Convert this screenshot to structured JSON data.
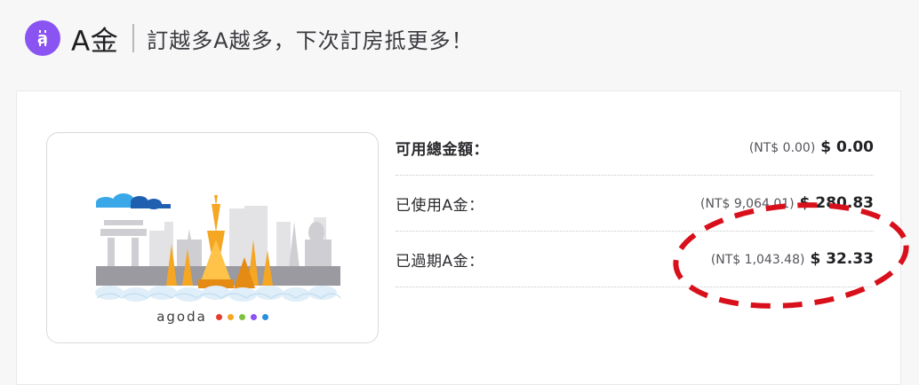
{
  "header": {
    "brand": "A金",
    "tagline": "訂越多A越多，下次訂房抵更多！",
    "coin_icon": "dollar-coin-icon",
    "accent": "#8a54f2"
  },
  "gift_card": {
    "logo_text": "agoda",
    "dot_colors": [
      "#e63b2e",
      "#f5a623",
      "#7fc242",
      "#8a54f2",
      "#2a8fe0"
    ]
  },
  "balances": [
    {
      "label": "可用總金額：",
      "ntd": "(NT$ 0.00)",
      "usd": "$ 0.00"
    },
    {
      "label": "已使用A金：",
      "ntd": "(NT$ 9,064.01)",
      "usd": "$ 280.83"
    },
    {
      "label": "已過期A金：",
      "ntd": "(NT$ 1,043.48)",
      "usd": "$ 32.33"
    }
  ],
  "annotation_color": "#d8101b"
}
